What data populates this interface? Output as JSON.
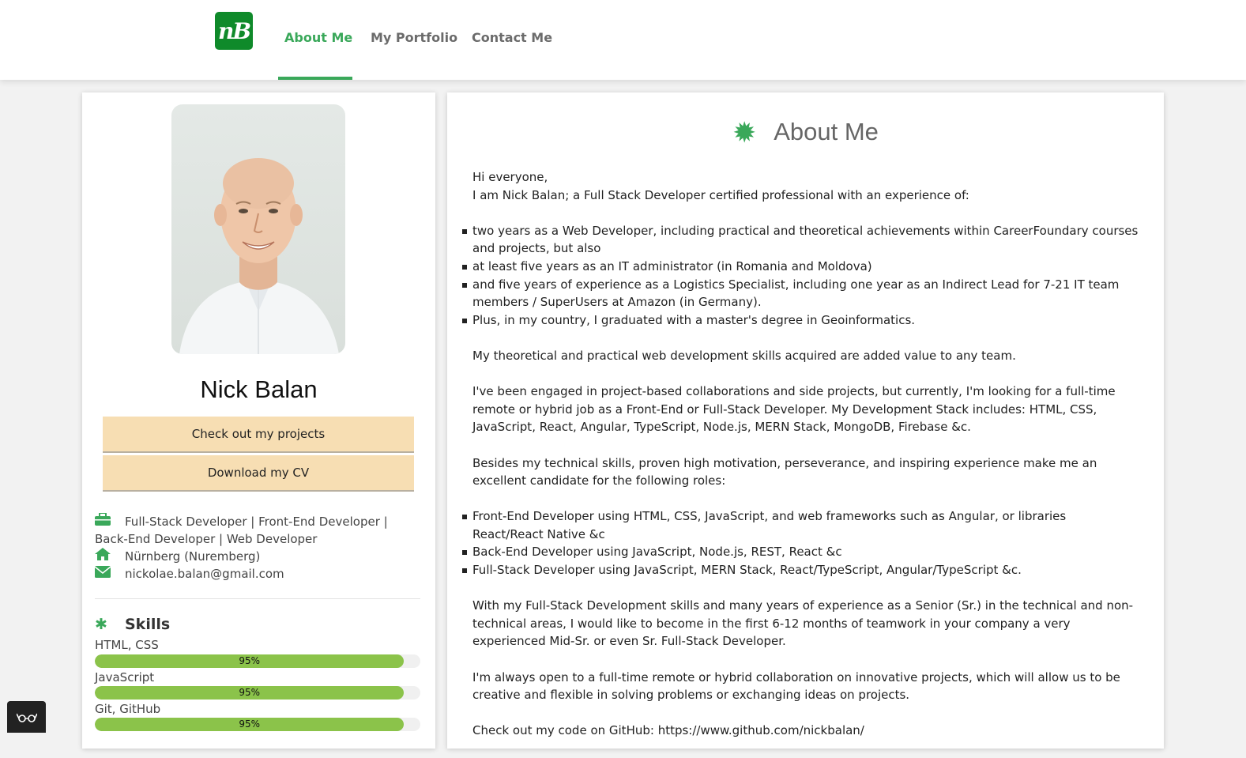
{
  "header": {
    "logo_text": "nB",
    "nav": [
      {
        "label": "About Me",
        "active": true
      },
      {
        "label": "My Portfolio",
        "active": false
      },
      {
        "label": "Contact Me",
        "active": false
      }
    ]
  },
  "profile": {
    "name": "Nick Balan",
    "buttons": {
      "projects": "Check out my projects",
      "cv": "Download my CV"
    },
    "role": "Full-Stack Developer | Front-End Developer | Back-End Developer | Web Developer",
    "location": "Nürnberg (Nuremberg)",
    "email": "nickolae.balan@gmail.com"
  },
  "skills": {
    "title": "Skills",
    "items": [
      {
        "label": "HTML, CSS",
        "percent_text": "95%",
        "level": 0.95
      },
      {
        "label": "JavaScript",
        "percent_text": "95%",
        "level": 0.95
      },
      {
        "label": "Git, GitHub",
        "percent_text": "95%",
        "level": 0.95
      }
    ]
  },
  "about": {
    "title": "About Me",
    "greeting": "Hi everyone,",
    "intro": "I am Nick Balan; a Full Stack Developer certified professional with an experience of:",
    "experience": [
      "two years as a Web Developer, including practical and theoretical achievements within CareerFoundary courses and projects, but also",
      "at least five years as an IT administrator (in Romania and Moldova)",
      "and five years of experience as a Logistics Specialist, including one year as an Indirect Lead for 7-21 IT team members / SuperUsers at Amazon (in Germany).",
      "Plus, in my country, I graduated with a master's degree in Geoinformatics."
    ],
    "p_value": "My theoretical and practical web development skills acquired are added value to any team.",
    "p_engaged": "I've been engaged in project-based collaborations and side projects, but currently, I'm looking for a full-time remote or hybrid job as a Front-End or Full-Stack Developer. My Development Stack includes: HTML, CSS, JavaScript, React, Angular, TypeScript, Node.js, MERN Stack, MongoDB, Firebase &c.",
    "p_besides": "Besides my technical skills, proven high motivation, perseverance, and inspiring experience make me an excellent candidate for the following roles:",
    "roles": [
      "Front-End Developer using HTML, CSS, JavaScript, and web frameworks such as Angular, or libraries React/React Native &c",
      "Back-End Developer using JavaScript, Node.js, REST, React &c",
      "Full-Stack Developer using JavaScript, MERN Stack, React/TypeScript, Angular/TypeScript &c."
    ],
    "p_with": "With my Full-Stack Development skills and many years of experience as a Senior (Sr.) in the technical and non-technical areas, I would like to become in the first 6-12 months of teamwork in your company a very experienced Mid-Sr. or even Sr. Full-Stack Developer.",
    "p_open": "I'm always open to a full-time remote or hybrid collaboration on innovative projects, which will allow us to be creative and flexible in solving problems or exchanging ideas on projects.",
    "p_github": "Check out my code on GitHub: https://www.github.com/nickbalan/"
  },
  "colors": {
    "accent": "#3aa85a",
    "logo_bg": "#0f8a2a",
    "button_bg": "#f7deb3",
    "skill_fill": "#8bc34a"
  }
}
